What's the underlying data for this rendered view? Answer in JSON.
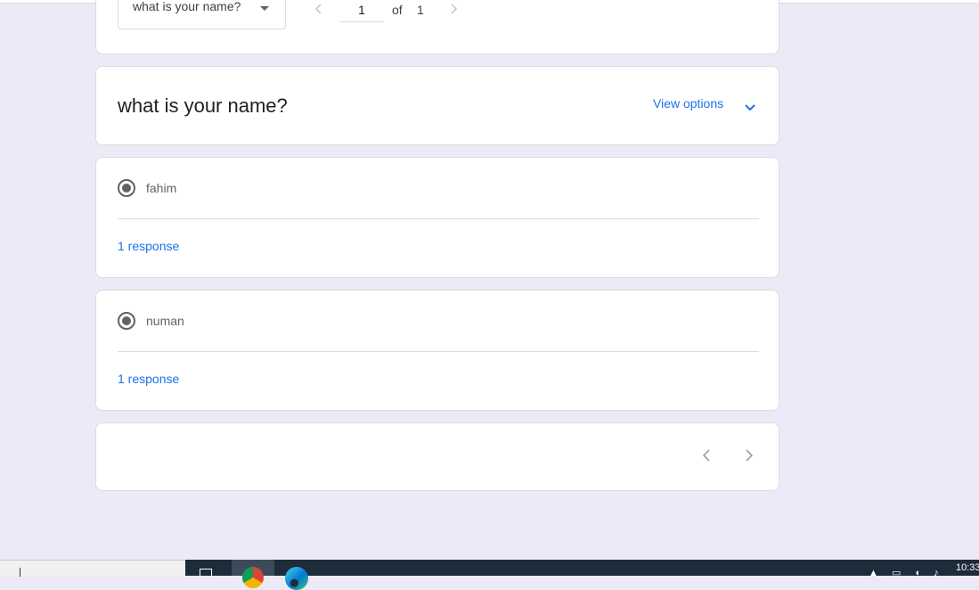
{
  "summary_card": {
    "question_select": {
      "value": "what is your name?"
    },
    "pager": {
      "current": "1",
      "of_label": "of",
      "total": "1"
    }
  },
  "question_card": {
    "title": "what is your name?",
    "view_options_label": "View options"
  },
  "answers": [
    {
      "text": "fahim",
      "responses_label": "1 response"
    },
    {
      "text": "numan",
      "responses_label": "1 response"
    }
  ],
  "taskbar": {
    "clock": "10:33",
    "apps": [
      "task-view-icon",
      "chrome-icon",
      "edge-icon"
    ]
  },
  "colors": {
    "background": "#ede9f7",
    "link": "#1a73e8",
    "card_border": "#dadce0",
    "taskbar": "#1d2b3a"
  }
}
